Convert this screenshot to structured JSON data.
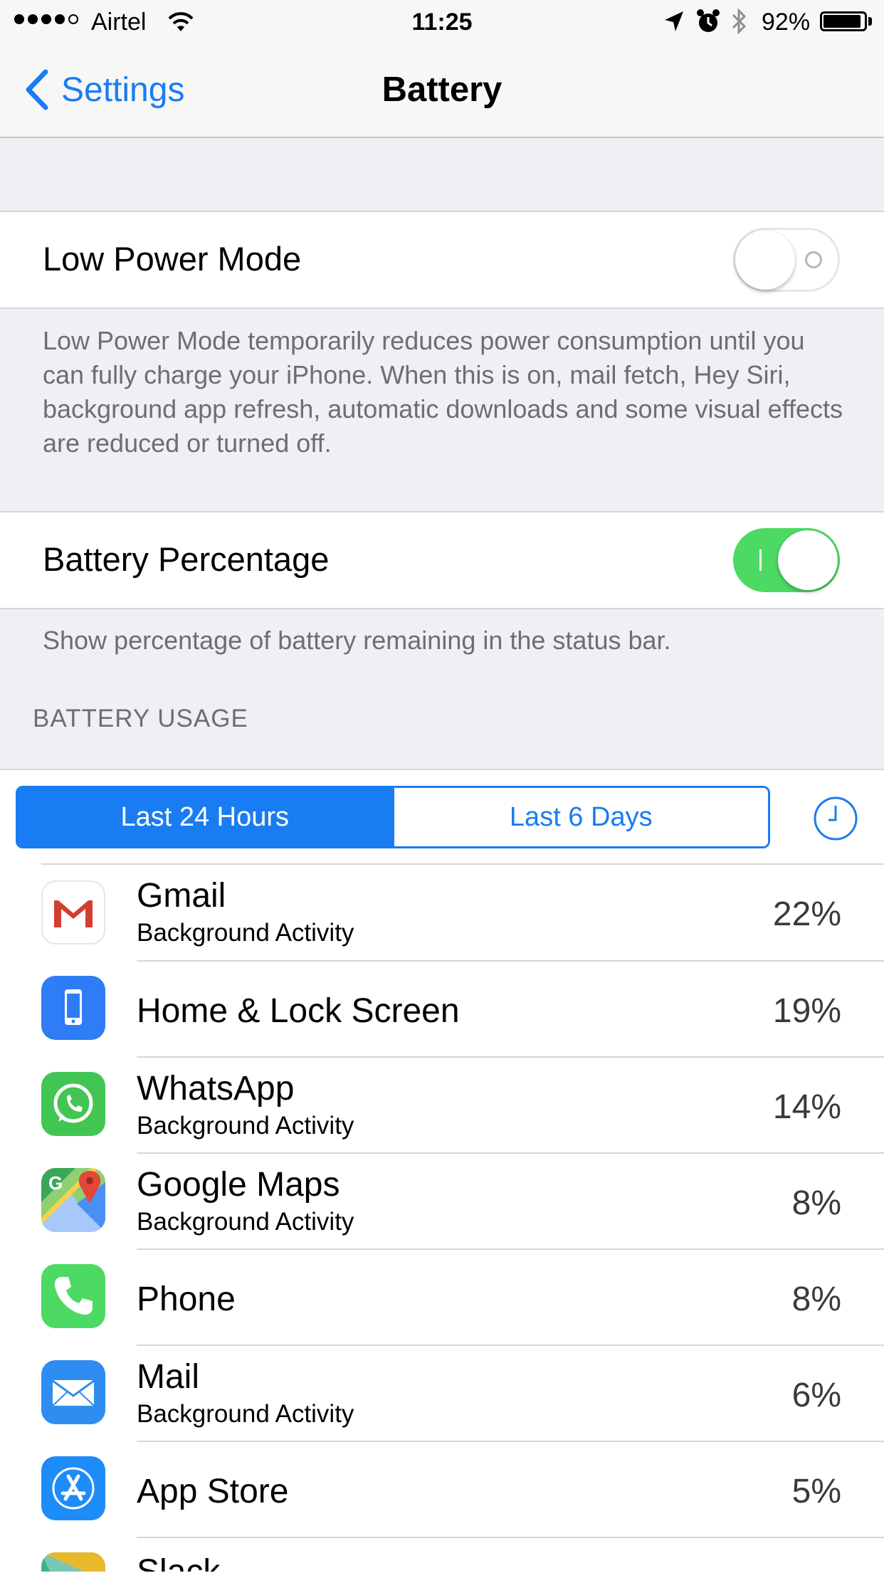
{
  "status_bar": {
    "carrier": "Airtel",
    "time": "11:25",
    "battery_percent": "92%",
    "signal_bars": 4,
    "battery_level": 0.92
  },
  "nav": {
    "back_label": "Settings",
    "title": "Battery"
  },
  "low_power": {
    "label": "Low Power Mode",
    "enabled": false,
    "footer": "Low Power Mode temporarily reduces power consumption until you can fully charge your iPhone. When this is on, mail fetch, Hey Siri, background app refresh, automatic downloads and some visual effects are reduced or turned off."
  },
  "battery_percentage": {
    "label": "Battery Percentage",
    "enabled": true,
    "footer": "Show percentage of battery remaining in the status bar."
  },
  "usage": {
    "header": "BATTERY USAGE",
    "segments": [
      "Last 24 Hours",
      "Last 6 Days"
    ],
    "selected_segment": "Last 24 Hours"
  },
  "apps": [
    {
      "name": "Gmail",
      "subtitle": "Background Activity",
      "percent": "22%",
      "icon": "gmail-icon"
    },
    {
      "name": "Home & Lock Screen",
      "subtitle": "",
      "percent": "19%",
      "icon": "home-lock-icon"
    },
    {
      "name": "WhatsApp",
      "subtitle": "Background Activity",
      "percent": "14%",
      "icon": "whatsapp-icon"
    },
    {
      "name": "Google Maps",
      "subtitle": "Background Activity",
      "percent": "8%",
      "icon": "google-maps-icon"
    },
    {
      "name": "Phone",
      "subtitle": "",
      "percent": "8%",
      "icon": "phone-icon"
    },
    {
      "name": "Mail",
      "subtitle": "Background Activity",
      "percent": "6%",
      "icon": "mail-icon"
    },
    {
      "name": "App Store",
      "subtitle": "",
      "percent": "5%",
      "icon": "app-store-icon"
    },
    {
      "name": "Slack",
      "subtitle": "",
      "percent": "",
      "icon": "slack-icon"
    }
  ],
  "colors": {
    "accent": "#1a7cf3",
    "switch_on": "#4cd964",
    "background": "#efeff4"
  }
}
